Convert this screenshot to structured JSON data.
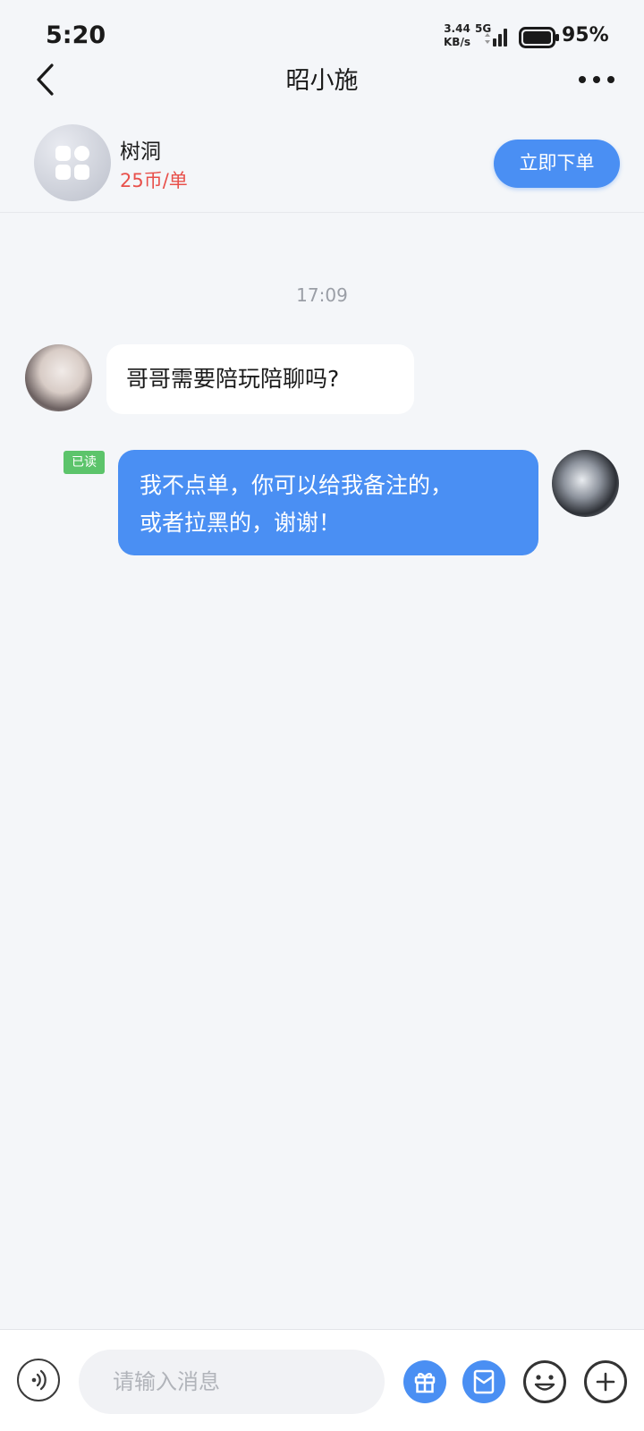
{
  "status_bar": {
    "time": "5:20",
    "net_speed_value": "3.44",
    "net_speed_unit": "KB/s",
    "network": "5G",
    "battery": "95%",
    "icons": [
      "signal-icon",
      "battery-icon"
    ]
  },
  "header": {
    "title": "昭小施",
    "icons": [
      "back-arrow-icon",
      "more-dots-icon"
    ]
  },
  "service": {
    "name": "树洞",
    "price": "25币/单",
    "order_label": "立即下单",
    "icon": "grid-apps-icon"
  },
  "chat": {
    "timestamp": "17:09",
    "messages": [
      {
        "from": "other",
        "text": "哥哥需要陪玩陪聊吗?"
      },
      {
        "from": "me",
        "read_label": "已读",
        "lines": [
          "我不点单，你可以给我备注的，",
          "或者拉黑的，谢谢！"
        ]
      }
    ]
  },
  "input_bar": {
    "placeholder": "请输入消息",
    "icons": [
      "voice-icon",
      "gift-icon",
      "red-packet-icon",
      "emoji-icon",
      "plus-icon"
    ]
  },
  "colors": {
    "accent": "#4a8ff3",
    "price": "#e8504b",
    "read_badge": "#5cc46b",
    "background": "#f4f6f9"
  }
}
